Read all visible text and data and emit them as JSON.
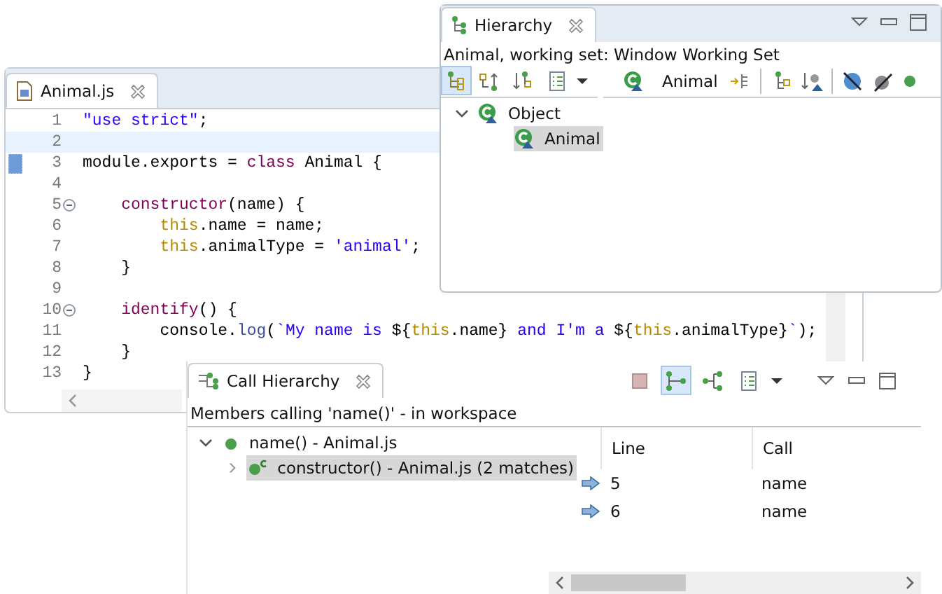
{
  "editor": {
    "tab": {
      "label": "Animal.js",
      "selected": true
    },
    "lines": [
      {
        "number": "1",
        "fold": false,
        "marker": false,
        "current": false,
        "tokens": [
          {
            "kind": "str",
            "text": "\"use strict\""
          },
          {
            "kind": "plain",
            "text": ";"
          }
        ]
      },
      {
        "number": "2",
        "fold": false,
        "marker": false,
        "current": true
      },
      {
        "number": "3",
        "fold": false,
        "marker": true,
        "current": false,
        "tokens": [
          {
            "kind": "plain",
            "text": "module.exports = "
          },
          {
            "kind": "kw",
            "text": "class"
          },
          {
            "kind": "plain",
            "text": " Animal {"
          }
        ]
      },
      {
        "number": "4",
        "fold": false,
        "marker": false,
        "current": false
      },
      {
        "number": "5",
        "fold": true,
        "marker": false,
        "current": false,
        "tokens": [
          {
            "kind": "kw",
            "text": "    constructor"
          },
          {
            "kind": "plain",
            "text": "(name) {"
          }
        ]
      },
      {
        "number": "6",
        "fold": false,
        "marker": false,
        "current": false,
        "tokens": [
          {
            "kind": "this",
            "text": "        this"
          },
          {
            "kind": "plain",
            "text": ".name = name;"
          }
        ]
      },
      {
        "number": "7",
        "fold": false,
        "marker": false,
        "current": false,
        "tokens": [
          {
            "kind": "this",
            "text": "        this"
          },
          {
            "kind": "plain",
            "text": ".animalType = "
          },
          {
            "kind": "str",
            "text": "'animal'"
          },
          {
            "kind": "plain",
            "text": ";"
          }
        ]
      },
      {
        "number": "8",
        "fold": false,
        "marker": false,
        "current": false,
        "tokens": [
          {
            "kind": "plain",
            "text": "    }"
          }
        ]
      },
      {
        "number": "9",
        "fold": false,
        "marker": false,
        "current": false
      },
      {
        "number": "10",
        "fold": true,
        "marker": false,
        "current": false,
        "tokens": [
          {
            "kind": "kw",
            "text": "    identify"
          },
          {
            "kind": "plain",
            "text": "() {"
          }
        ]
      },
      {
        "number": "11",
        "fold": false,
        "marker": false,
        "current": false,
        "tokens": [
          {
            "kind": "plain",
            "text": "        console."
          },
          {
            "kind": "method",
            "text": "log"
          },
          {
            "kind": "plain",
            "text": "("
          },
          {
            "kind": "str",
            "text": "`My name is "
          },
          {
            "kind": "plain",
            "text": "${"
          },
          {
            "kind": "this",
            "text": "this"
          },
          {
            "kind": "plain",
            "text": ".name}"
          },
          {
            "kind": "str",
            "text": " and I'm a "
          },
          {
            "kind": "plain",
            "text": "${"
          },
          {
            "kind": "this",
            "text": "this"
          },
          {
            "kind": "plain",
            "text": ".animalType}"
          },
          {
            "kind": "str",
            "text": "`"
          },
          {
            "kind": "plain",
            "text": ");"
          }
        ]
      },
      {
        "number": "12",
        "fold": false,
        "marker": false,
        "current": false,
        "tokens": [
          {
            "kind": "plain",
            "text": "    }"
          }
        ]
      },
      {
        "number": "13",
        "fold": false,
        "marker": false,
        "current": false,
        "tokens": [
          {
            "kind": "plain",
            "text": "}"
          }
        ]
      }
    ]
  },
  "hierarchy": {
    "title": "Hierarchy",
    "description": "Animal, working set: Window Working Set",
    "view_buttons": [
      {
        "kind": "type-hierarchy",
        "selected": true
      },
      {
        "kind": "supertype",
        "selected": false
      },
      {
        "kind": "subtype",
        "selected": false
      },
      {
        "kind": "history",
        "selected": false
      }
    ],
    "focus_label": "Animal",
    "tree": [
      {
        "label": "Object",
        "expanded": true,
        "selected": false,
        "children": [
          {
            "label": "Animal",
            "selected": true
          }
        ]
      }
    ]
  },
  "call_hierarchy": {
    "title": "Call Hierarchy",
    "toolbar": [
      {
        "kind": "stop",
        "selected": false
      },
      {
        "kind": "callers",
        "selected": true
      },
      {
        "kind": "callees",
        "selected": false
      },
      {
        "kind": "history",
        "selected": false
      }
    ],
    "description": "Members calling 'name()' - in workspace",
    "tree": [
      {
        "label": "name() - Animal.js",
        "expanded": true,
        "selected": false,
        "children": [
          {
            "label": "constructor() - Animal.js (2 matches)",
            "expanded": false,
            "selected": true
          }
        ]
      }
    ],
    "columns": [
      "Line",
      "Call"
    ],
    "rows": [
      {
        "line": "5",
        "call": "name"
      },
      {
        "line": "6",
        "call": "name"
      }
    ]
  }
}
